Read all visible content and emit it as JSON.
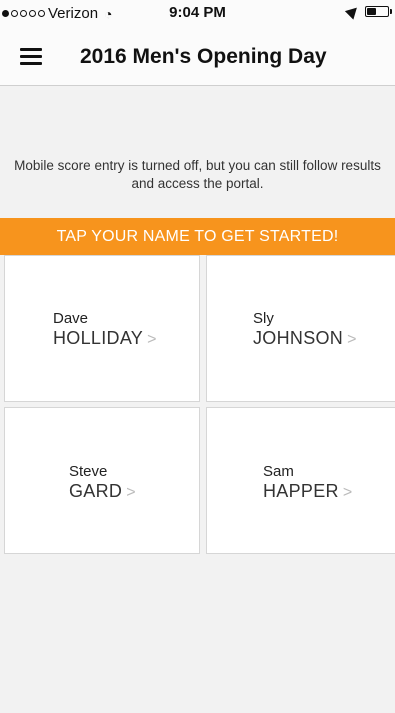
{
  "status_bar": {
    "carrier": "Verizon",
    "time": "9:04 PM",
    "signal_bars_filled": 1,
    "signal_bars_total": 5
  },
  "header": {
    "title": "2016 Men's Opening Day"
  },
  "notice": "Mobile score entry is turned off, but you can still follow results and access the portal.",
  "cta": {
    "label": "TAP YOUR NAME TO GET STARTED!",
    "color": "#f7941d"
  },
  "players": [
    {
      "first": "Dave",
      "last": "HOLLIDAY",
      "chevron": ">"
    },
    {
      "first": "Sly",
      "last": "JOHNSON",
      "chevron": ">"
    },
    {
      "first": "Steve",
      "last": "GARD",
      "chevron": ">"
    },
    {
      "first": "Sam",
      "last": "HAPPER",
      "chevron": ">"
    }
  ]
}
